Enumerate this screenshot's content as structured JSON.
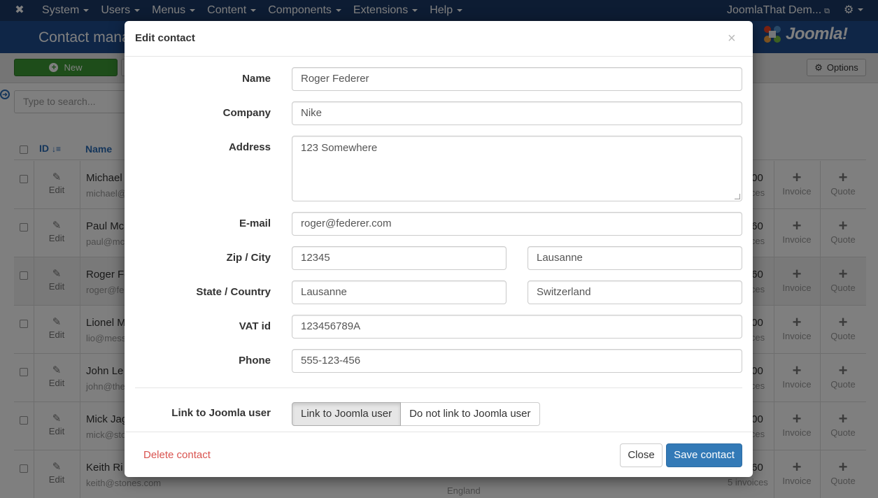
{
  "navbar": {
    "menu": [
      {
        "label": "System"
      },
      {
        "label": "Users"
      },
      {
        "label": "Menus"
      },
      {
        "label": "Content"
      },
      {
        "label": "Components"
      },
      {
        "label": "Extensions"
      },
      {
        "label": "Help"
      }
    ],
    "site_link": "JoomlaThat Dem...",
    "settings_icon": "gear-icon"
  },
  "header": {
    "title": "Contact mana",
    "logo_text": "Joomla!"
  },
  "toolbar": {
    "new_label": "New",
    "options_label": "Options"
  },
  "filter": {
    "search_placeholder": "Type to search..."
  },
  "table": {
    "columns": {
      "id": "ID",
      "name": "Name"
    },
    "edit_label": "Edit",
    "invoice_label": "Invoice",
    "quote_label": "Quote",
    "rows": [
      {
        "name": "Michael",
        "email": "michael@",
        "amount": ".00",
        "invoices": "ices"
      },
      {
        "name": "Paul Mc",
        "email": "paul@mc",
        "amount": ".60",
        "invoices": "ices"
      },
      {
        "name": "Roger Fe",
        "email": "roger@fe",
        "amount": ".60",
        "invoices": "ices"
      },
      {
        "name": "Lionel M",
        "email": "lio@mess",
        "amount": ".00",
        "invoices": "ices"
      },
      {
        "name": "John Le",
        "email": "john@the",
        "amount": ".00",
        "invoices": "ices"
      },
      {
        "name": "Mick Jag",
        "email": "mick@sto",
        "amount": ".00",
        "invoices": "ices"
      },
      {
        "name": "Keith Ri",
        "email": "keith@stones.com",
        "country": "England",
        "amount": ".60",
        "invoices": "5 invoices"
      }
    ]
  },
  "modal": {
    "title": "Edit contact",
    "close_symbol": "×",
    "fields": {
      "name_label": "Name",
      "name_value": "Roger Federer",
      "company_label": "Company",
      "company_value": "Nike",
      "address_label": "Address",
      "address_value": "123 Somewhere",
      "email_label": "E-mail",
      "email_value": "roger@federer.com",
      "zipcity_label": "Zip / City",
      "zip_value": "12345",
      "city_value": "Lausanne",
      "statecountry_label": "State / Country",
      "state_value": "Lausanne",
      "country_value": "Switzerland",
      "vat_label": "VAT id",
      "vat_value": "123456789A",
      "phone_label": "Phone",
      "phone_value": "555-123-456",
      "link_label": "Link to Joomla user",
      "link_option_yes": "Link to Joomla user",
      "link_option_no": "Do not link to Joomla user"
    },
    "footer": {
      "delete_label": "Delete contact",
      "close_label": "Close",
      "save_label": "Save contact"
    }
  },
  "colors": {
    "navbar": "#1a3867",
    "subheader": "#1f4d8f",
    "new_button": "#3d9b34",
    "primary": "#337ab7",
    "danger": "#d9534f"
  }
}
